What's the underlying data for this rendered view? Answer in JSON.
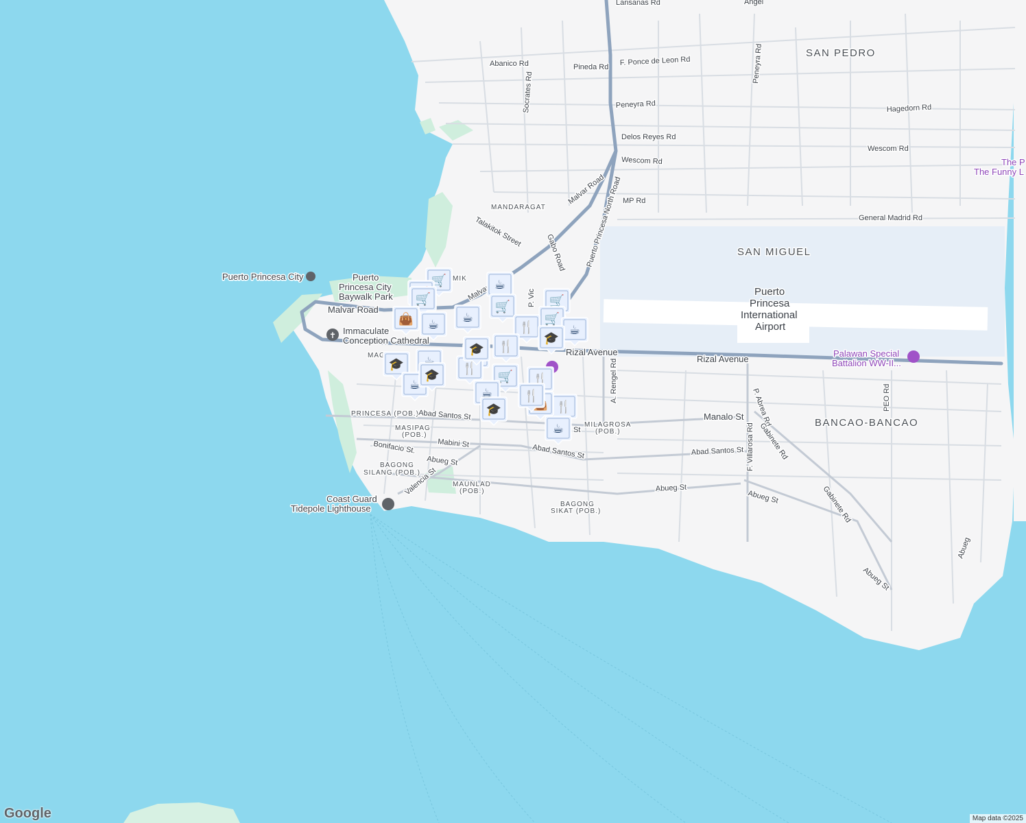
{
  "areas": [
    {
      "text": "SAN PEDRO"
    },
    {
      "text": "SAN MIGUEL"
    },
    {
      "text": "BANCAO-BANCAO"
    },
    {
      "text": "MANDARAGAT"
    }
  ],
  "small_areas": [
    {
      "text": "PRINCESA (POB.)"
    },
    {
      "text": "MASIPAG"
    },
    {
      "text": "(POB.)"
    },
    {
      "text": "BAGONG"
    },
    {
      "text": "SILANG (POB.)"
    },
    {
      "text": "MAUNLAD"
    },
    {
      "text": "(POB.)"
    },
    {
      "text": "BAGONG"
    },
    {
      "text": "SIKAT (POB.)"
    },
    {
      "text": "MILAGROSA"
    },
    {
      "text": "(POB.)"
    },
    {
      "text": "MIK"
    },
    {
      "text": "MAG"
    }
  ],
  "roads": [
    "Lansanas Rd",
    "Angel",
    "Abanico Rd",
    "Pineda Rd",
    "F. Ponce de Leon Rd",
    "Peneyra Rd",
    "Socrates Rd",
    "Peneyra Rd",
    "Hagedorn Rd",
    "Delos Reyes Rd",
    "Wescom Rd",
    "Wescom Rd",
    "MP Rd",
    "General Madrid Rd",
    "Malvar Road",
    "Puerto Princesa North Road",
    "Talakitok Street",
    "Gabo Road",
    "Malvar Road",
    "Malvar Road",
    "P. Vic",
    "Rizal Avenue",
    "Rizal Avenue",
    "A. Rengel Rd",
    "P. Abrea Rd",
    "Manalo St",
    "Abad Santos St",
    "Abad Santos St",
    "Abad Santos St",
    "Mabini St",
    "Bonifacio St.",
    "Abueg St",
    "Valencia St",
    "Abueg St",
    "Abueg St",
    "Gabinete Rd",
    "Gabinete Rd",
    "F. Villarosa Rd",
    "PEO Rd",
    "Abueg St",
    "Abueg",
    "St"
  ],
  "pois": {
    "city": "Puerto Princesa City",
    "baywalk_1": "Puerto",
    "baywalk_2": "Princesa City",
    "baywalk_3": "Baywalk Park",
    "cathedral_1": "Immaculate",
    "cathedral_2": "Conception Cathedral",
    "lighthouse_1": "Coast Guard",
    "lighthouse_2": "Tidepole Lighthouse",
    "airport_1": "Puerto",
    "airport_2": "Princesa",
    "airport_3": "International",
    "airport_4": "Airport",
    "museum_1": "Palawan Special",
    "museum_2": "Battalion WW-II...",
    "funny_1": "The P",
    "funny_2": "The Funny L"
  },
  "markers": [
    {
      "icon": "cart-icon"
    },
    {
      "icon": "cart-icon"
    },
    {
      "icon": "cart-icon"
    },
    {
      "icon": "coffee-icon"
    },
    {
      "icon": "shopping-bag-icon"
    },
    {
      "icon": "coffee-icon"
    },
    {
      "icon": "coffee-icon"
    },
    {
      "icon": "coffee-icon"
    },
    {
      "icon": "cart-icon"
    },
    {
      "icon": "cart-icon"
    },
    {
      "icon": "cart-icon"
    },
    {
      "icon": "restaurant-icon"
    },
    {
      "icon": "coffee-icon"
    },
    {
      "icon": "coffee-icon"
    },
    {
      "icon": "school-icon"
    },
    {
      "icon": "school-icon"
    },
    {
      "icon": "coffee-icon"
    },
    {
      "icon": "school-icon"
    },
    {
      "icon": "school-icon"
    },
    {
      "icon": "restaurant-icon"
    },
    {
      "icon": "restaurant-icon"
    },
    {
      "icon": "cart-icon"
    },
    {
      "icon": "restaurant-icon"
    },
    {
      "icon": "coffee-icon"
    },
    {
      "icon": "school-icon"
    },
    {
      "icon": "restaurant-icon"
    },
    {
      "icon": "shopping-bag-icon"
    },
    {
      "icon": "restaurant-icon"
    },
    {
      "icon": "coffee-icon"
    },
    {
      "icon": "school-icon"
    }
  ],
  "attribution": "Map data ©2025",
  "logo": "Google",
  "colors": {
    "water": "#8dd8ee",
    "land": "#f5f5f6",
    "park": "#cfeedd",
    "road_major": "#8ea3bd",
    "road_minor": "#d8dde3",
    "airport": "#e6eef7",
    "marker_bg": "#e8f0fe",
    "marker_icon": "#1a3a63"
  }
}
